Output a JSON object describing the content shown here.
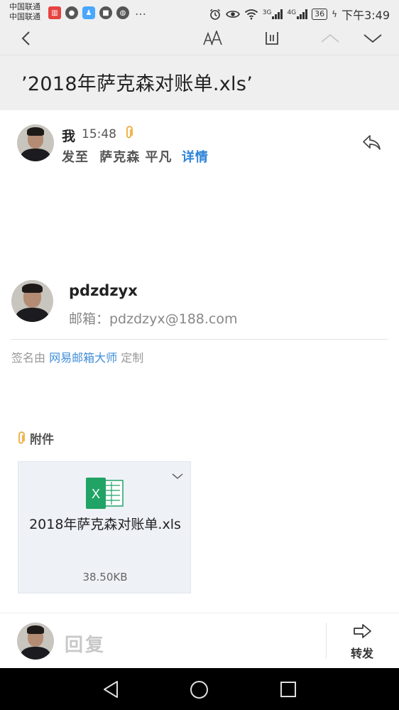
{
  "status_bar": {
    "carrier_1": "中国联通",
    "carrier_2": "中国联通",
    "network_1": "3G",
    "network_2": "4G",
    "battery": "36",
    "time": "下午3:49"
  },
  "toolbar": {
    "back_icon": "chevron-left-icon",
    "font_size_icon": "font-size-icon",
    "trash_icon": "trash-icon",
    "prev_icon": "chevron-up-icon",
    "next_icon": "chevron-down-icon"
  },
  "email": {
    "subject": "’2018年萨克森对账单.xls’",
    "sender": "我",
    "sent_time": "15:48",
    "recipients_prefix": "发至",
    "recipients": "萨克森 平凡",
    "details_link": "详情"
  },
  "signature": {
    "name": "pdzdzyx",
    "email_line": "邮箱：pdzdzyx@188.com",
    "note_prefix": "签名由",
    "note_link": "网易邮箱大师",
    "note_suffix": "定制"
  },
  "attachments": {
    "title": "附件",
    "items": [
      {
        "name": "2018年萨克森对账单.xls",
        "size": "38.50KB",
        "icon": "excel-icon"
      }
    ]
  },
  "bottom_bar": {
    "reply_placeholder": "回复",
    "forward_label": "转发"
  },
  "colors": {
    "accent_blue": "#2f84d8",
    "attachment_orange": "#f0a830",
    "excel_green": "#21a366",
    "header_bg": "#efeff0"
  }
}
